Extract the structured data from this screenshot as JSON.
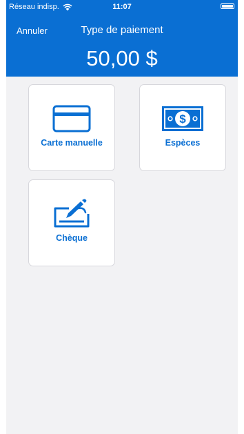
{
  "status_bar": {
    "carrier": "Réseau indisp.",
    "time": "11:07",
    "wifi_icon": "wifi-icon",
    "battery_icon": "battery-icon"
  },
  "header": {
    "cancel_label": "Annuler",
    "title": "Type de paiement",
    "amount": "50,00 $"
  },
  "payment_options": [
    {
      "label": "Carte manuelle",
      "icon": "credit-card-icon"
    },
    {
      "label": "Espèces",
      "icon": "banknote-icon"
    },
    {
      "label": "Chèque",
      "icon": "check-signing-icon"
    }
  ],
  "colors": {
    "accent": "#0a6fd3",
    "background": "#f2f2f4",
    "tile_border": "#d7d7dc"
  }
}
